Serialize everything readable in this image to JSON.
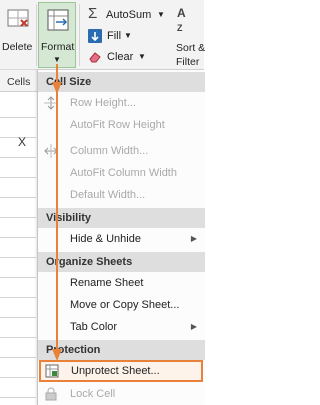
{
  "ribbon": {
    "delete_label": "Delete",
    "format_label": "Format",
    "autosum_label": "AutoSum",
    "fill_label": "Fill",
    "clear_label": "Clear",
    "sort_label": "Sort &",
    "filter_label": "Filter",
    "group_cells_label": "Cells"
  },
  "sheet": {
    "cell_mark": "X"
  },
  "menu": {
    "sections": {
      "cell_size": "Cell Size",
      "visibility": "Visibility",
      "organize": "Organize Sheets",
      "protection": "Protection"
    },
    "items": {
      "row_height": "Row Height...",
      "autofit_row": "AutoFit Row Height",
      "column_width": "Column Width...",
      "autofit_column": "AutoFit Column Width",
      "default_width": "Default Width...",
      "hide_unhide": "Hide & Unhide",
      "rename_sheet": "Rename Sheet",
      "move_copy": "Move or Copy Sheet...",
      "tab_color": "Tab Color",
      "unprotect": "Unprotect Sheet...",
      "lock_cell": "Lock Cell"
    }
  },
  "colors": {
    "highlight": "#e8823a",
    "format_button_bg": "#d5e8d4",
    "section_bg": "#dedede"
  }
}
